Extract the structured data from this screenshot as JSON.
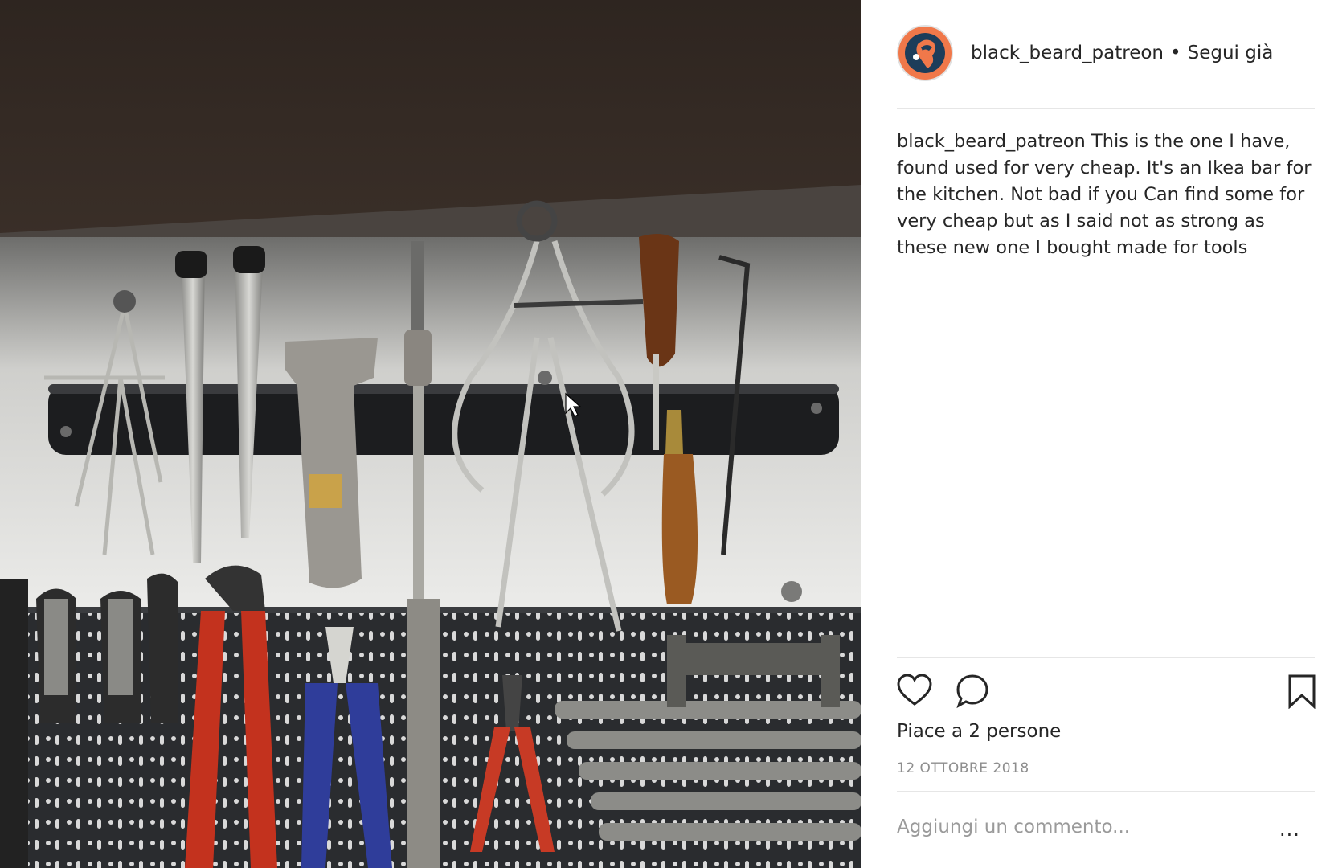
{
  "post": {
    "username": "black_beard_patreon",
    "separator": "•",
    "follow_label": "Segui già",
    "caption_user": "black_beard_patreon",
    "caption_text": "This is the one I have, found used for very cheap. It's an Ikea bar for the kitchen. Not bad if you Can find some for very cheap but as I said not as strong as these new one I bought made for tools",
    "likes_text": "Piace a 2 persone",
    "date_text": "12 OTTOBRE 2018",
    "comment_placeholder": "Aggiungi un commento...",
    "more_label": "..."
  },
  "icons": {
    "like": "heart-icon",
    "comment": "speech-bubble-icon",
    "save": "bookmark-icon"
  },
  "colors": {
    "avatar_ring": "#f0784a",
    "avatar_bg": "#1d3d5a",
    "text": "#262626",
    "muted": "#8e8e8e",
    "divider": "#e6e6e6"
  }
}
